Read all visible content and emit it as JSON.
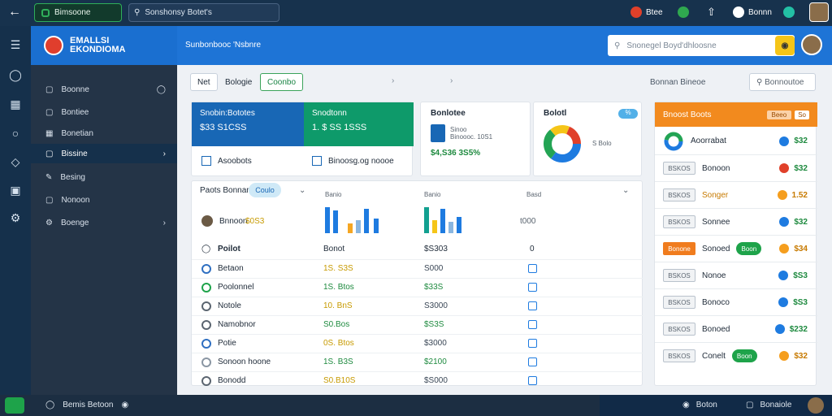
{
  "topbar": {
    "back_icon": "arrow-left-icon",
    "green_button": "Bimsoone",
    "search_value": "Sonshonsy Botet's",
    "items": [
      {
        "label": "Btee",
        "color": "#e0402a"
      },
      {
        "label": "",
        "color": "#2fa84f"
      },
      {
        "label": "",
        "color": "#ffffff"
      },
      {
        "label": "Bonnn",
        "color": "#ffffff"
      },
      {
        "label": "",
        "color": "#23c0a5"
      }
    ]
  },
  "brand": {
    "line1": "EMALLSI",
    "line2": "EKONDIOMA"
  },
  "sidebar": {
    "items": [
      {
        "label": "Boonne"
      },
      {
        "label": "Bontiee"
      },
      {
        "label": "Bonetian"
      },
      {
        "label": "Bissine"
      },
      {
        "label": "Besing"
      },
      {
        "label": "Nonoon"
      },
      {
        "label": "Boenge"
      }
    ]
  },
  "header": {
    "title": "Sunbonbooc 'Nsbnre",
    "search_placeholder": "Snonegel Boyd'dhloosne"
  },
  "tabs": [
    {
      "label": "Net"
    },
    {
      "label": "Bologie"
    },
    {
      "label": "Coonbo"
    }
  ],
  "tabs_right": {
    "label": "Bonnan Bineoe",
    "search": "Bonnoutoe"
  },
  "kpi1": {
    "left_title": "Snobin:Bototes",
    "left_value": "$33 S1CSS",
    "right_title": "Snodtonn",
    "right_value": "1.  $ SS 1SSS",
    "link1": "Asoobots",
    "link2": "Binoosg.og  noooe"
  },
  "kpi2": {
    "title": "Bonlotee",
    "sub1": "Sinoo",
    "sub2": "Binoooc. 10S1",
    "value": "$4,S36 3S5%"
  },
  "kpi3": {
    "title": "Bolotl",
    "badge": "%",
    "legend": "S  Bolo"
  },
  "donut_colors": [
    "#1e7be0",
    "#23a454",
    "#f5c518",
    "#e0402a"
  ],
  "table": {
    "top_label": "Paots Bonnan",
    "bubble": "Coulo",
    "col_labels": [
      "Banio",
      "Banio",
      "Basd"
    ],
    "first_name": "Bnnoon",
    "first_value": "$0S3",
    "axis_val": "t000",
    "header": {
      "name": "Poilot",
      "col2": "Bonot",
      "col3": "$S303",
      "col4": "0"
    },
    "rows": [
      {
        "name": "Betaon",
        "v1": "1S. S3S",
        "v2": "S000",
        "c1": "#2f6fc1"
      },
      {
        "name": "Poolonnel",
        "v1": "1S. Btos",
        "v2": "$33S",
        "c1": "#1ea34a"
      },
      {
        "name": "Notole",
        "v1": "10.  BnS",
        "v2": "S3000",
        "c1": "#5b6570"
      },
      {
        "name": "Namobnor",
        "v1": "S0.Bos",
        "v2": "$S3S",
        "c1": "#5b6570"
      },
      {
        "name": "Potie",
        "v1": "0S. Btos",
        "v2": "$3000",
        "c1": "#2f6fc1"
      },
      {
        "name": "Sonoon  hoone",
        "v1": "1S. B3S",
        "v2": "$2100",
        "c1": "#8a96a3"
      },
      {
        "name": "Bonodd",
        "v1": "S0.B10S",
        "v2": "$S000",
        "c1": "#5b6570"
      }
    ]
  },
  "right_panel": {
    "title": "Bnoost Boots",
    "badge1": "Beeo",
    "badge2": "So",
    "first_name": "Aoorrabat",
    "first_value": "$32",
    "rows": [
      {
        "chip": "BSKOS",
        "name": "Bonoon",
        "value": "$32",
        "dot": "#e0402a",
        "chip_orange": false,
        "pill": ""
      },
      {
        "chip": "BSKOS",
        "name": "Songer",
        "value": "1.52",
        "dot": "#f59e1e",
        "chip_orange": false,
        "pill": ""
      },
      {
        "chip": "BSKOS",
        "name": "Sonnee",
        "value": "$32",
        "dot": "#1e7be0",
        "chip_orange": false,
        "pill": ""
      },
      {
        "chip": "Bonone",
        "name": "Sonoed",
        "value": "$34",
        "dot": "#f59e1e",
        "chip_orange": true,
        "pill": "Boon"
      },
      {
        "chip": "BSKOS",
        "name": "Nonoe",
        "value": "$S3",
        "dot": "#1e7be0",
        "chip_orange": false,
        "pill": ""
      },
      {
        "chip": "BSKOS",
        "name": "Bonoco",
        "value": "$S3",
        "dot": "#1e7be0",
        "chip_orange": false,
        "pill": ""
      },
      {
        "chip": "BSKOS",
        "name": "Bonoed",
        "value": "$232",
        "dot": "#1e7be0",
        "chip_orange": false,
        "pill": ""
      },
      {
        "chip": "BSKOS",
        "name": "Conelt",
        "value": "$32",
        "dot": "#f59e1e",
        "chip_orange": false,
        "pill": "Boon"
      }
    ]
  },
  "bottombar": {
    "left": "Bemis  Betoon",
    "right1": "Boton",
    "right2": "Bonaiole"
  }
}
